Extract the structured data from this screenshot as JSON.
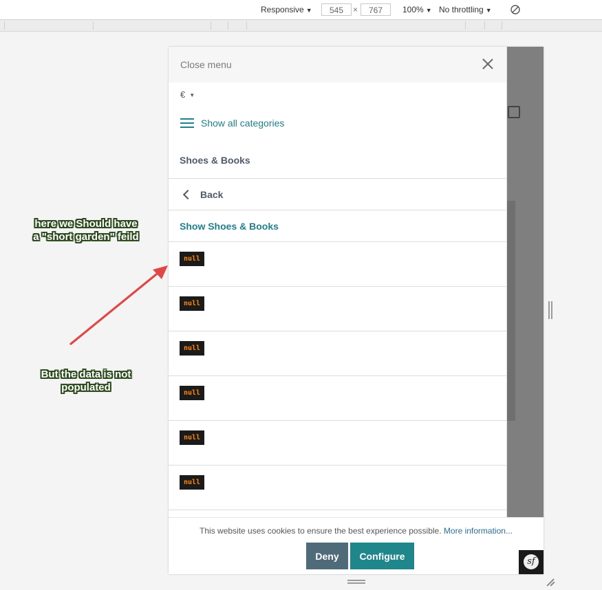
{
  "devtools": {
    "device": "Responsive",
    "width": "545",
    "times": "×",
    "height": "767",
    "zoom": "100%",
    "throttling": "No throttling"
  },
  "menu": {
    "close_label": "Close menu",
    "currency": "€",
    "show_all": "Show all categories",
    "section_title": "Shoes & Books",
    "back": "Back",
    "show_category": "Show Shoes & Books",
    "items": [
      "null",
      "null",
      "null",
      "null",
      "null",
      "null"
    ]
  },
  "cookie": {
    "message": "This website uses cookies to ensure the best experience possible.",
    "more_info": "More information...",
    "deny": "Deny",
    "configure": "Configure"
  },
  "symfony_badge": "sf",
  "annotations": {
    "line1": "here we Should have",
    "line2": "a \"short garden\" feild",
    "line3": "But the data is not",
    "line4": "populated"
  },
  "colors": {
    "accent": "#1f7f8a",
    "deny_button": "#4f6b7a",
    "configure_button": "#1f868c",
    "annotation_arrow": "#e04848",
    "null_text": "#ff8800"
  }
}
